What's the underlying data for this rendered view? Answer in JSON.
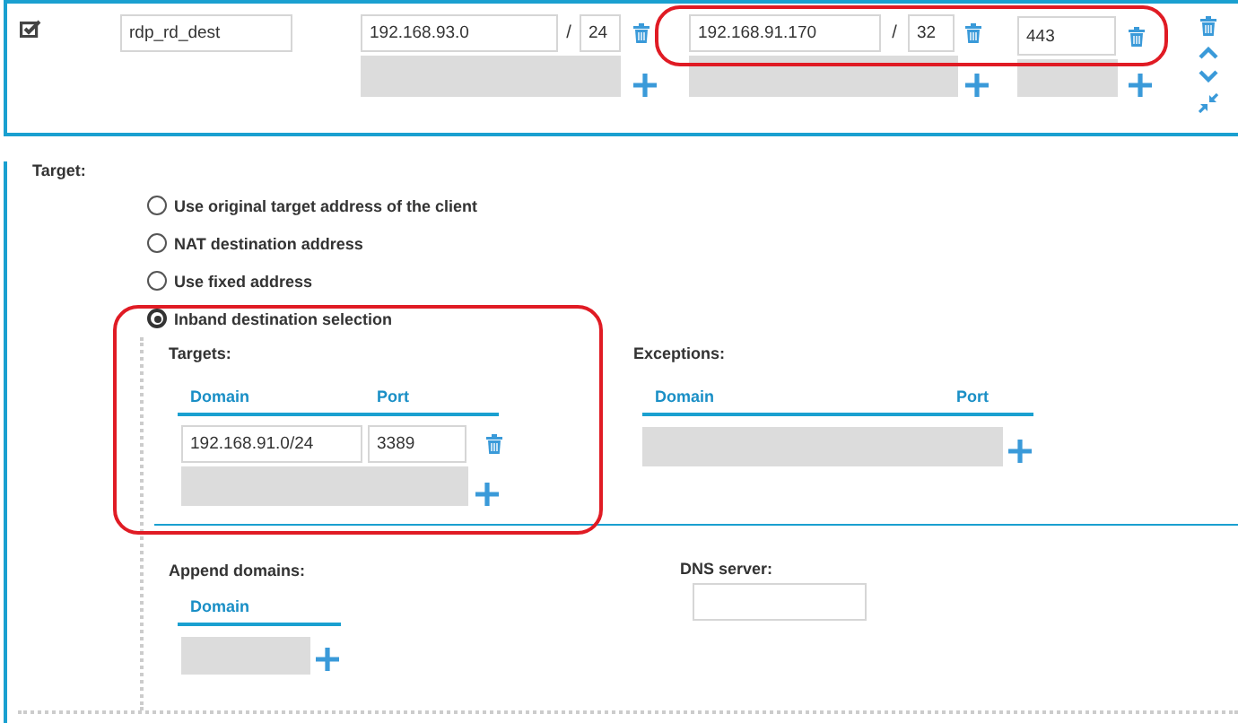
{
  "rule": {
    "enabled": true,
    "name": "rdp_rd_dest",
    "source": {
      "address": "192.168.93.0",
      "separator": "/",
      "mask": "24"
    },
    "destination": {
      "address": "192.168.91.170",
      "separator": "/",
      "mask": "32"
    },
    "port": "443"
  },
  "target": {
    "label": "Target:",
    "options": [
      {
        "label": "Use original target address of the client",
        "selected": false
      },
      {
        "label": "NAT destination address",
        "selected": false
      },
      {
        "label": "Use fixed address",
        "selected": false
      },
      {
        "label": "Inband destination selection",
        "selected": true
      }
    ]
  },
  "targets": {
    "label": "Targets:",
    "columns": [
      "Domain",
      "Port"
    ],
    "rows": [
      {
        "domain": "192.168.91.0/24",
        "port": "3389"
      }
    ]
  },
  "exceptions": {
    "label": "Exceptions:",
    "columns": [
      "Domain",
      "Port"
    ]
  },
  "append_domains": {
    "label": "Append domains:",
    "columns": [
      "Domain"
    ]
  },
  "dns_server": {
    "label": "DNS server:"
  }
}
